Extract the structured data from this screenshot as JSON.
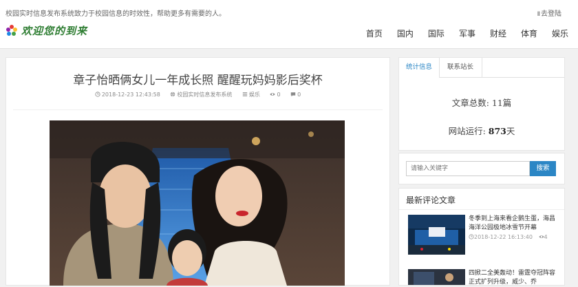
{
  "header": {
    "slogan": "校园实时信息发布系统致力于校园信息的时效性，帮助更多有需要的人。",
    "login_label": "去登陆",
    "logo_text": "欢迎您的到来",
    "nav": [
      "首页",
      "国内",
      "国际",
      "军事",
      "财经",
      "体育",
      "娱乐"
    ]
  },
  "article": {
    "title": "章子怡晒俩女儿一年成长照 醒醒玩妈妈影后奖杯",
    "date": "2018-12-23 12:43:58",
    "source": "校园实时信息发布系统",
    "category": "娱乐",
    "views": "0",
    "comments": "0"
  },
  "stats": {
    "tab_active": "统计信息",
    "tab_other": "联系站长",
    "articles_label": "文章总数: ",
    "articles_value": "11篇",
    "running_label": "网站运行: ",
    "running_value": "873",
    "running_unit": "天"
  },
  "search": {
    "placeholder": "请输入关键字",
    "button": "搜索"
  },
  "recent": {
    "title": "最新评论文章",
    "items": [
      {
        "title": "冬季到上海来看企鹅生蛋，海昌海洋公园极地冰雪节开幕",
        "date": "2018-12-22 16:13:40",
        "comments": "4"
      },
      {
        "title": "四掀二全美轰动！雷霆夺冠阵容正式扩列升级，威少、乔"
      }
    ]
  },
  "colors": {
    "accent": "#2b86c5",
    "logo": "#2e7d32"
  }
}
